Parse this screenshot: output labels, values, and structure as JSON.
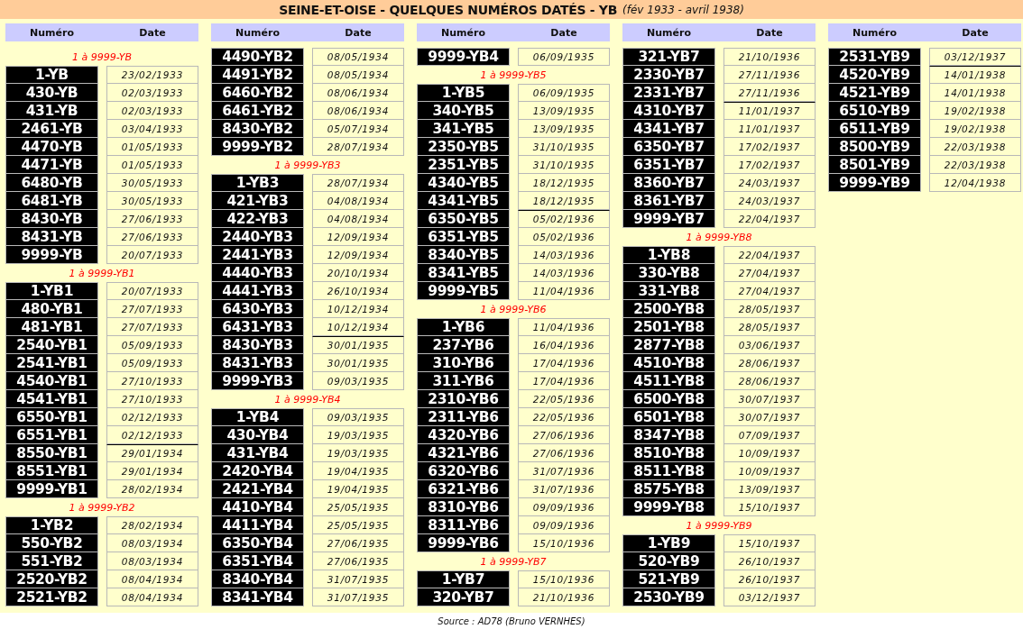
{
  "title": "SEINE-ET-OISE - QUELQUES NUMÉROS DATÉS - YB",
  "subtitle": "(fév 1933 - avril 1938)",
  "columns": [
    {
      "headers": [
        "Numéro",
        "Date"
      ],
      "groups": [
        {
          "heading": "1 à 9999-YB",
          "rows": [
            {
              "number": "1-YB",
              "date": "23/02/1933",
              "year_break": false
            },
            {
              "number": "430-YB",
              "date": "02/03/1933",
              "year_break": false
            },
            {
              "number": "431-YB",
              "date": "02/03/1933",
              "year_break": false
            },
            {
              "number": "2461-YB",
              "date": "03/04/1933",
              "year_break": false
            },
            {
              "number": "4470-YB",
              "date": "01/05/1933",
              "year_break": false
            },
            {
              "number": "4471-YB",
              "date": "01/05/1933",
              "year_break": false
            },
            {
              "number": "6480-YB",
              "date": "30/05/1933",
              "year_break": false
            },
            {
              "number": "6481-YB",
              "date": "30/05/1933",
              "year_break": false
            },
            {
              "number": "8430-YB",
              "date": "27/06/1933",
              "year_break": false
            },
            {
              "number": "8431-YB",
              "date": "27/06/1933",
              "year_break": false
            },
            {
              "number": "9999-YB",
              "date": "20/07/1933",
              "year_break": false
            }
          ]
        },
        {
          "heading": "1 à 9999-YB1",
          "rows": [
            {
              "number": "1-YB1",
              "date": "20/07/1933",
              "year_break": false
            },
            {
              "number": "480-YB1",
              "date": "27/07/1933",
              "year_break": false
            },
            {
              "number": "481-YB1",
              "date": "27/07/1933",
              "year_break": false
            },
            {
              "number": "2540-YB1",
              "date": "05/09/1933",
              "year_break": false
            },
            {
              "number": "2541-YB1",
              "date": "05/09/1933",
              "year_break": false
            },
            {
              "number": "4540-YB1",
              "date": "27/10/1933",
              "year_break": false
            },
            {
              "number": "4541-YB1",
              "date": "27/10/1933",
              "year_break": false
            },
            {
              "number": "6550-YB1",
              "date": "02/12/1933",
              "year_break": false
            },
            {
              "number": "6551-YB1",
              "date": "02/12/1933",
              "year_break": false
            },
            {
              "number": "8550-YB1",
              "date": "29/01/1934",
              "year_break": true
            },
            {
              "number": "8551-YB1",
              "date": "29/01/1934",
              "year_break": false
            },
            {
              "number": "9999-YB1",
              "date": "28/02/1934",
              "year_break": false
            }
          ]
        },
        {
          "heading": "1 à 9999-YB2",
          "rows": [
            {
              "number": "1-YB2",
              "date": "28/02/1934",
              "year_break": false
            },
            {
              "number": "550-YB2",
              "date": "08/03/1934",
              "year_break": false
            },
            {
              "number": "551-YB2",
              "date": "08/03/1934",
              "year_break": false
            },
            {
              "number": "2520-YB2",
              "date": "08/04/1934",
              "year_break": false
            },
            {
              "number": "2521-YB2",
              "date": "08/04/1934",
              "year_break": false
            }
          ]
        }
      ]
    },
    {
      "headers": [
        "Numéro",
        "Date"
      ],
      "groups": [
        {
          "rows": [
            {
              "number": "4490-YB2",
              "date": "08/05/1934",
              "year_break": false
            },
            {
              "number": "4491-YB2",
              "date": "08/05/1934",
              "year_break": false
            },
            {
              "number": "6460-YB2",
              "date": "08/06/1934",
              "year_break": false
            },
            {
              "number": "6461-YB2",
              "date": "08/06/1934",
              "year_break": false
            },
            {
              "number": "8430-YB2",
              "date": "05/07/1934",
              "year_break": false
            },
            {
              "number": "9999-YB2",
              "date": "28/07/1934",
              "year_break": false
            }
          ]
        },
        {
          "heading": "1 à 9999-YB3",
          "rows": [
            {
              "number": "1-YB3",
              "date": "28/07/1934",
              "year_break": false
            },
            {
              "number": "421-YB3",
              "date": "04/08/1934",
              "year_break": false
            },
            {
              "number": "422-YB3",
              "date": "04/08/1934",
              "year_break": false
            },
            {
              "number": "2440-YB3",
              "date": "12/09/1934",
              "year_break": false
            },
            {
              "number": "2441-YB3",
              "date": "12/09/1934",
              "year_break": false
            },
            {
              "number": "4440-YB3",
              "date": "20/10/1934",
              "year_break": false
            },
            {
              "number": "4441-YB3",
              "date": "26/10/1934",
              "year_break": false
            },
            {
              "number": "6430-YB3",
              "date": "10/12/1934",
              "year_break": false
            },
            {
              "number": "6431-YB3",
              "date": "10/12/1934",
              "year_break": false
            },
            {
              "number": "8430-YB3",
              "date": "30/01/1935",
              "year_break": true
            },
            {
              "number": "8431-YB3",
              "date": "30/01/1935",
              "year_break": false
            },
            {
              "number": "9999-YB3",
              "date": "09/03/1935",
              "year_break": false
            }
          ]
        },
        {
          "heading": "1 à 9999-YB4",
          "rows": [
            {
              "number": "1-YB4",
              "date": "09/03/1935",
              "year_break": false
            },
            {
              "number": "430-YB4",
              "date": "19/03/1935",
              "year_break": false
            },
            {
              "number": "431-YB4",
              "date": "19/03/1935",
              "year_break": false
            },
            {
              "number": "2420-YB4",
              "date": "19/04/1935",
              "year_break": false
            },
            {
              "number": "2421-YB4",
              "date": "19/04/1935",
              "year_break": false
            },
            {
              "number": "4410-YB4",
              "date": "25/05/1935",
              "year_break": false
            },
            {
              "number": "4411-YB4",
              "date": "25/05/1935",
              "year_break": false
            },
            {
              "number": "6350-YB4",
              "date": "27/06/1935",
              "year_break": false
            },
            {
              "number": "6351-YB4",
              "date": "27/06/1935",
              "year_break": false
            },
            {
              "number": "8340-YB4",
              "date": "31/07/1935",
              "year_break": false
            },
            {
              "number": "8341-YB4",
              "date": "31/07/1935",
              "year_break": false
            }
          ]
        }
      ]
    },
    {
      "headers": [
        "Numéro",
        "Date"
      ],
      "groups": [
        {
          "rows": [
            {
              "number": "9999-YB4",
              "date": "06/09/1935",
              "year_break": false
            }
          ]
        },
        {
          "heading": "1 à 9999-YB5",
          "rows": [
            {
              "number": "1-YB5",
              "date": "06/09/1935",
              "year_break": false
            },
            {
              "number": "340-YB5",
              "date": "13/09/1935",
              "year_break": false
            },
            {
              "number": "341-YB5",
              "date": "13/09/1935",
              "year_break": false
            },
            {
              "number": "2350-YB5",
              "date": "31/10/1935",
              "year_break": false
            },
            {
              "number": "2351-YB5",
              "date": "31/10/1935",
              "year_break": false
            },
            {
              "number": "4340-YB5",
              "date": "18/12/1935",
              "year_break": false
            },
            {
              "number": "4341-YB5",
              "date": "18/12/1935",
              "year_break": false
            },
            {
              "number": "6350-YB5",
              "date": "05/02/1936",
              "year_break": true
            },
            {
              "number": "6351-YB5",
              "date": "05/02/1936",
              "year_break": false
            },
            {
              "number": "8340-YB5",
              "date": "14/03/1936",
              "year_break": false
            },
            {
              "number": "8341-YB5",
              "date": "14/03/1936",
              "year_break": false
            },
            {
              "number": "9999-YB5",
              "date": "11/04/1936",
              "year_break": false
            }
          ]
        },
        {
          "heading": "1 à 9999-YB6",
          "rows": [
            {
              "number": "1-YB6",
              "date": "11/04/1936",
              "year_break": false
            },
            {
              "number": "237-YB6",
              "date": "16/04/1936",
              "year_break": false
            },
            {
              "number": "310-YB6",
              "date": "17/04/1936",
              "year_break": false
            },
            {
              "number": "311-YB6",
              "date": "17/04/1936",
              "year_break": false
            },
            {
              "number": "2310-YB6",
              "date": "22/05/1936",
              "year_break": false
            },
            {
              "number": "2311-YB6",
              "date": "22/05/1936",
              "year_break": false
            },
            {
              "number": "4320-YB6",
              "date": "27/06/1936",
              "year_break": false
            },
            {
              "number": "4321-YB6",
              "date": "27/06/1936",
              "year_break": false
            },
            {
              "number": "6320-YB6",
              "date": "31/07/1936",
              "year_break": false
            },
            {
              "number": "6321-YB6",
              "date": "31/07/1936",
              "year_break": false
            },
            {
              "number": "8310-YB6",
              "date": "09/09/1936",
              "year_break": false
            },
            {
              "number": "8311-YB6",
              "date": "09/09/1936",
              "year_break": false
            },
            {
              "number": "9999-YB6",
              "date": "15/10/1936",
              "year_break": false
            }
          ]
        },
        {
          "heading": "1 à 9999-YB7",
          "rows": [
            {
              "number": "1-YB7",
              "date": "15/10/1936",
              "year_break": false
            },
            {
              "number": "320-YB7",
              "date": "21/10/1936",
              "year_break": false
            }
          ]
        }
      ]
    },
    {
      "headers": [
        "Numéro",
        "Date"
      ],
      "groups": [
        {
          "rows": [
            {
              "number": "321-YB7",
              "date": "21/10/1936",
              "year_break": false
            },
            {
              "number": "2330-YB7",
              "date": "27/11/1936",
              "year_break": false
            },
            {
              "number": "2331-YB7",
              "date": "27/11/1936",
              "year_break": false
            },
            {
              "number": "4310-YB7",
              "date": "11/01/1937",
              "year_break": true
            },
            {
              "number": "4341-YB7",
              "date": "11/01/1937",
              "year_break": false
            },
            {
              "number": "6350-YB7",
              "date": "17/02/1937",
              "year_break": false
            },
            {
              "number": "6351-YB7",
              "date": "17/02/1937",
              "year_break": false
            },
            {
              "number": "8360-YB7",
              "date": "24/03/1937",
              "year_break": false
            },
            {
              "number": "8361-YB7",
              "date": "24/03/1937",
              "year_break": false
            },
            {
              "number": "9999-YB7",
              "date": "22/04/1937",
              "year_break": false
            }
          ]
        },
        {
          "heading": "1 à 9999-YB8",
          "rows": [
            {
              "number": "1-YB8",
              "date": "22/04/1937",
              "year_break": false
            },
            {
              "number": "330-YB8",
              "date": "27/04/1937",
              "year_break": false
            },
            {
              "number": "331-YB8",
              "date": "27/04/1937",
              "year_break": false
            },
            {
              "number": "2500-YB8",
              "date": "28/05/1937",
              "year_break": false
            },
            {
              "number": "2501-YB8",
              "date": "28/05/1937",
              "year_break": false
            },
            {
              "number": "2877-YB8",
              "date": "03/06/1937",
              "year_break": false
            },
            {
              "number": "4510-YB8",
              "date": "28/06/1937",
              "year_break": false
            },
            {
              "number": "4511-YB8",
              "date": "28/06/1937",
              "year_break": false
            },
            {
              "number": "6500-YB8",
              "date": "30/07/1937",
              "year_break": false
            },
            {
              "number": "6501-YB8",
              "date": "30/07/1937",
              "year_break": false
            },
            {
              "number": "8347-YB8",
              "date": "07/09/1937",
              "year_break": false
            },
            {
              "number": "8510-YB8",
              "date": "10/09/1937",
              "year_break": false
            },
            {
              "number": "8511-YB8",
              "date": "10/09/1937",
              "year_break": false
            },
            {
              "number": "8575-YB8",
              "date": "13/09/1937",
              "year_break": false
            },
            {
              "number": "9999-YB8",
              "date": "15/10/1937",
              "year_break": false
            }
          ]
        },
        {
          "heading": "1 à 9999-YB9",
          "rows": [
            {
              "number": "1-YB9",
              "date": "15/10/1937",
              "year_break": false
            },
            {
              "number": "520-YB9",
              "date": "26/10/1937",
              "year_break": false
            },
            {
              "number": "521-YB9",
              "date": "26/10/1937",
              "year_break": false
            },
            {
              "number": "2530-YB9",
              "date": "03/12/1937",
              "year_break": false
            }
          ]
        }
      ]
    },
    {
      "headers": [
        "Numéro",
        "Date"
      ],
      "groups": [
        {
          "rows": [
            {
              "number": "2531-YB9",
              "date": "03/12/1937",
              "year_break": false
            },
            {
              "number": "4520-YB9",
              "date": "14/01/1938",
              "year_break": true
            },
            {
              "number": "4521-YB9",
              "date": "14/01/1938",
              "year_break": false
            },
            {
              "number": "6510-YB9",
              "date": "19/02/1938",
              "year_break": false
            },
            {
              "number": "6511-YB9",
              "date": "19/02/1938",
              "year_break": false
            },
            {
              "number": "8500-YB9",
              "date": "22/03/1938",
              "year_break": false
            },
            {
              "number": "8501-YB9",
              "date": "22/03/1938",
              "year_break": false
            },
            {
              "number": "9999-YB9",
              "date": "12/04/1938",
              "year_break": false
            }
          ]
        }
      ]
    }
  ],
  "source": "Source : AD78 (Bruno VERNHES)"
}
